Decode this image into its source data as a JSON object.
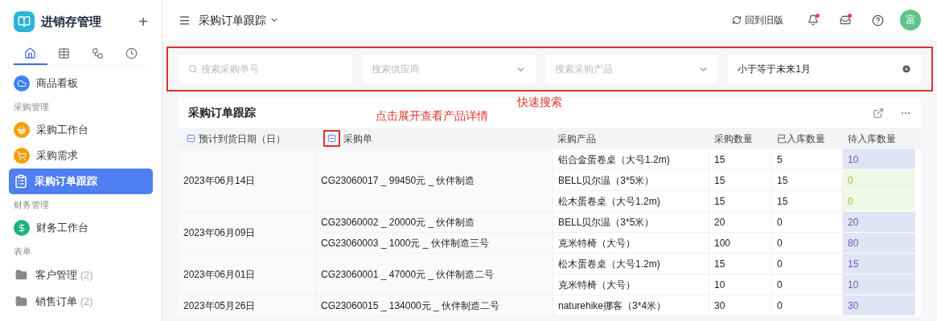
{
  "sidebar": {
    "app_title": "进销存管理",
    "add_label": "+",
    "tabs": [
      {
        "selected": true
      },
      {
        "selected": false
      },
      {
        "selected": false
      },
      {
        "selected": false
      }
    ],
    "items": [
      {
        "kind": "item",
        "label": "商品看板",
        "selected": false
      },
      {
        "kind": "section",
        "label": "采购管理"
      },
      {
        "kind": "item",
        "label": "采购工作台",
        "selected": false
      },
      {
        "kind": "item",
        "label": "采购需求",
        "selected": false
      },
      {
        "kind": "item",
        "label": "采购订单跟踪",
        "selected": true
      },
      {
        "kind": "section",
        "label": "财务管理"
      },
      {
        "kind": "item",
        "label": "财务工作台",
        "selected": false
      },
      {
        "kind": "section",
        "label": "表单"
      },
      {
        "kind": "folder",
        "label": "客户管理",
        "count": "(2)"
      },
      {
        "kind": "folder",
        "label": "销售订单",
        "count": "(2)"
      }
    ]
  },
  "header": {
    "title": "采购订单跟踪",
    "old_version": "回到旧版",
    "avatar": "富"
  },
  "filters": [
    {
      "kind": "search",
      "placeholder": "搜索采购单号"
    },
    {
      "kind": "select",
      "placeholder": "搜索供应商"
    },
    {
      "kind": "select",
      "placeholder": "搜索采购产品"
    },
    {
      "kind": "value",
      "value": "小于等于未来1月"
    }
  ],
  "annotations": {
    "search": "快速搜索",
    "expand": "点击展开查看产品详情"
  },
  "table": {
    "title": "采购订单跟踪",
    "columns": [
      "预计到货日期（日）",
      "采购单",
      "采购产品",
      "采购数量",
      "已入库数量",
      "待入库数量"
    ],
    "groups": [
      {
        "date": "2023年06月14日",
        "orders": [
          {
            "order": "CG23060017 _ 99450元 _ 伙伴制造",
            "products": [
              {
                "name": "铝合金蛋卷桌（大号1.2m)",
                "qty": "15",
                "received": "5",
                "pending": "10",
                "complete": false
              },
              {
                "name": "BELL贝尔温（3*5米）",
                "qty": "15",
                "received": "15",
                "pending": "0",
                "complete": true
              },
              {
                "name": "松木蛋卷桌（大号1.2m)",
                "qty": "15",
                "received": "15",
                "pending": "0",
                "complete": true
              }
            ]
          }
        ]
      },
      {
        "date": "2023年06月09日",
        "orders": [
          {
            "order": "CG23060002 _ 20000元 _ 伙伴制造",
            "products": [
              {
                "name": "BELL贝尔温（3*5米）",
                "qty": "20",
                "received": "0",
                "pending": "20",
                "complete": false
              }
            ]
          },
          {
            "order": "CG23060003 _ 1000元 _ 伙伴制造三号",
            "products": [
              {
                "name": "克米特椅（大号）",
                "qty": "100",
                "received": "0",
                "pending": "80",
                "complete": false
              }
            ]
          }
        ]
      },
      {
        "date": "2023年06月01日",
        "orders": [
          {
            "order": "CG23060001 _ 47000元 _ 伙伴制造二号",
            "products": [
              {
                "name": "松木蛋卷桌（大号1.2m)",
                "qty": "15",
                "received": "0",
                "pending": "15",
                "complete": false
              },
              {
                "name": "克米特椅（大号）",
                "qty": "10",
                "received": "0",
                "pending": "10",
                "complete": false
              }
            ]
          }
        ]
      },
      {
        "date": "2023年05月26日",
        "orders": [
          {
            "order": "CG23060015 _ 134000元 _ 伙伴制造二号",
            "products": [
              {
                "name": "naturehike挪客（3*4米）",
                "qty": "30",
                "received": "0",
                "pending": "30",
                "complete": false
              }
            ]
          }
        ]
      }
    ]
  }
}
